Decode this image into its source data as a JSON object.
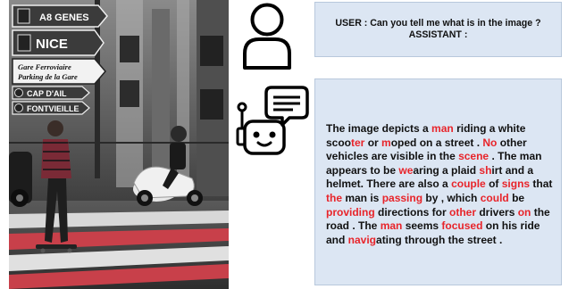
{
  "photo": {
    "signs": [
      {
        "text": "A8 GENES"
      },
      {
        "text": "NICE"
      },
      {
        "line1": "Gare Ferroviaire",
        "line2": "Parking de la Gare"
      },
      {
        "text": "CAP D'AIL"
      },
      {
        "text": "FONTVIEILLE"
      }
    ]
  },
  "chat": {
    "user_line": "USER : Can you tell me what is in the image ?",
    "assistant_line": "ASSISTANT :",
    "response_segments": [
      {
        "t": "The image depicts a ",
        "hl": false
      },
      {
        "t": "man",
        "hl": true
      },
      {
        "t": "  riding a white scoo",
        "hl": false
      },
      {
        "t": "ter",
        "hl": true
      },
      {
        "t": " or ",
        "hl": false
      },
      {
        "t": "m",
        "hl": true
      },
      {
        "t": "oped on a street . ",
        "hl": false
      },
      {
        "t": "No",
        "hl": true
      },
      {
        "t": " other vehicles are visible in the ",
        "hl": false
      },
      {
        "t": "scene",
        "hl": true
      },
      {
        "t": " . The man appears to be ",
        "hl": false
      },
      {
        "t": "we",
        "hl": true
      },
      {
        "t": "aring a plaid ",
        "hl": false
      },
      {
        "t": "sh",
        "hl": true
      },
      {
        "t": "irt and a helmet. There are also a ",
        "hl": false
      },
      {
        "t": "couple",
        "hl": true
      },
      {
        "t": " of ",
        "hl": false
      },
      {
        "t": "signs",
        "hl": true
      },
      {
        "t": " that ",
        "hl": false
      },
      {
        "t": "the",
        "hl": true
      },
      {
        "t": " man is ",
        "hl": false
      },
      {
        "t": "passing",
        "hl": true
      },
      {
        "t": " by , which ",
        "hl": false
      },
      {
        "t": "could",
        "hl": true
      },
      {
        "t": " be ",
        "hl": false
      },
      {
        "t": "providing",
        "hl": true
      },
      {
        "t": " directions for ",
        "hl": false
      },
      {
        "t": "other",
        "hl": true
      },
      {
        "t": " drivers ",
        "hl": false
      },
      {
        "t": "on",
        "hl": true
      },
      {
        "t": " the road . The ",
        "hl": false
      },
      {
        "t": "man",
        "hl": true
      },
      {
        "t": " seems ",
        "hl": false
      },
      {
        "t": "focused",
        "hl": true
      },
      {
        "t": " on his ride and ",
        "hl": false
      },
      {
        "t": "navig",
        "hl": true
      },
      {
        "t": "ating through the street .",
        "hl": false
      }
    ]
  },
  "colors": {
    "highlight": "#e8242a",
    "box_background": "#dce6f3",
    "box_border": "#b8c8dc",
    "crosswalk_red": "#c8404a"
  },
  "icons": {
    "user": "user-icon",
    "assistant": "robot-icon"
  }
}
